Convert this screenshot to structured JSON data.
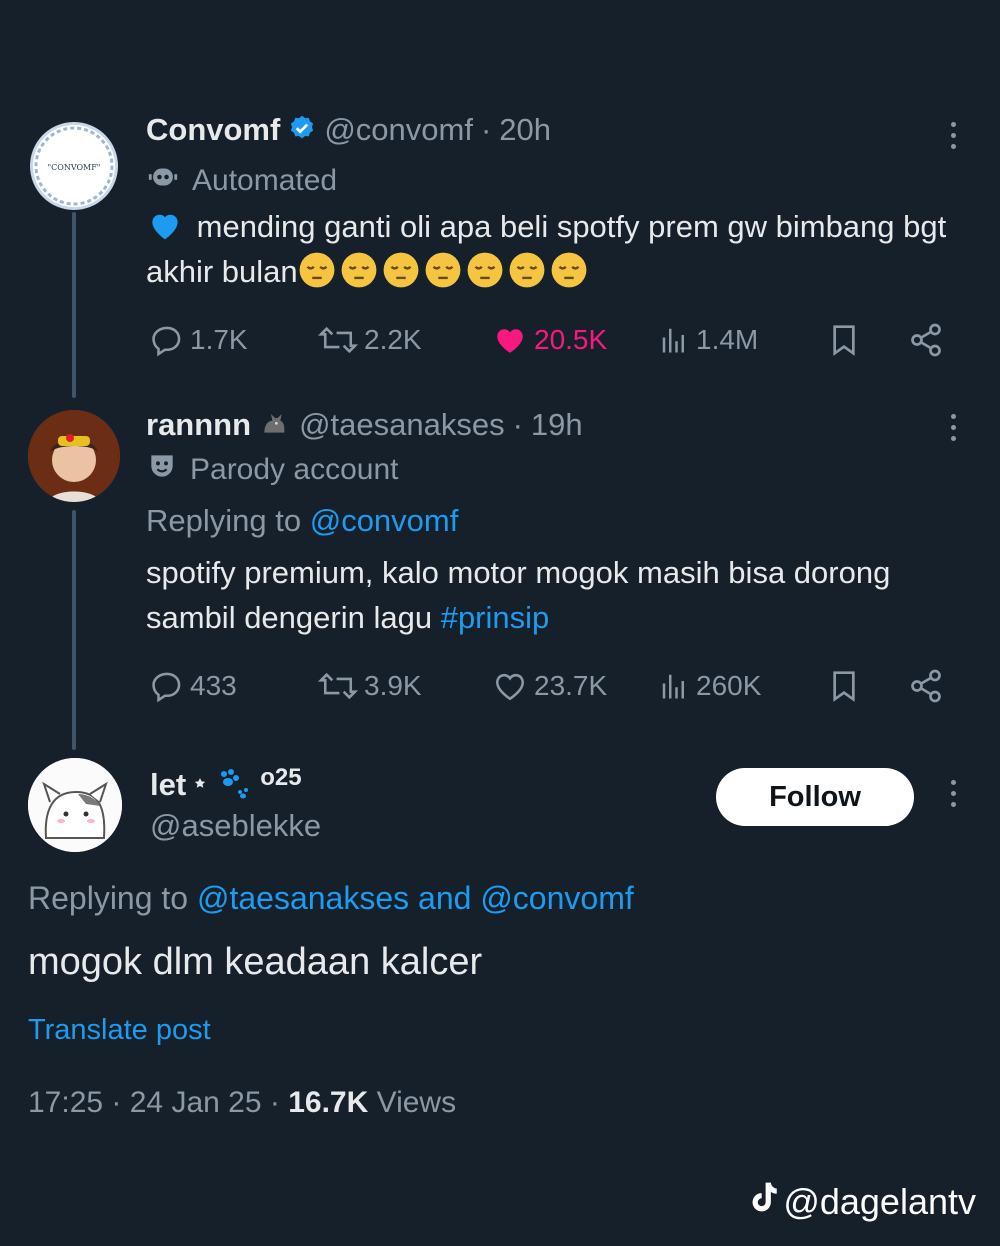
{
  "tweets": [
    {
      "display_name": "Convomf",
      "handle": "@convomf",
      "time": "20h",
      "avatar_text": "\"CONVOMF\"",
      "label": "Automated",
      "text": "mending ganti oli apa beli spotfy prem gw bimbang bgt akhir bulan",
      "emoji_count": 7,
      "stats": {
        "replies": "1.7K",
        "reposts": "2.2K",
        "likes": "20.5K",
        "views": "1.4M"
      },
      "liked": true
    },
    {
      "display_name": "rannnn",
      "handle": "@taesanakses",
      "time": "19h",
      "label": "Parody account",
      "replying_prefix": "Replying to",
      "replying_to": "@convomf",
      "text_main": "spotify premium, kalo motor mogok masih bisa dorong sambil dengerin lagu",
      "hashtag": "#prinsip",
      "stats": {
        "replies": "433",
        "reposts": "3.9K",
        "likes": "23.7K",
        "views": "260K"
      },
      "liked": false
    }
  ],
  "main_post": {
    "display_name": "let",
    "name_suffix": "o25",
    "handle": "@aseblekke",
    "follow_label": "Follow",
    "replying_prefix": "Replying to",
    "replying_to": "@taesanakses and @convomf",
    "text": "mogok dlm keadaan kalcer",
    "translate_label": "Translate post",
    "time": "17:25",
    "date": "24 Jan 25",
    "views_count": "16.7K",
    "views_label": "Views"
  },
  "watermark": "@dagelantv",
  "colors": {
    "background": "#15202b",
    "accent": "#1d9bf0",
    "like": "#f91880",
    "muted": "#8b98a5",
    "verified": "#1d9bf0"
  }
}
